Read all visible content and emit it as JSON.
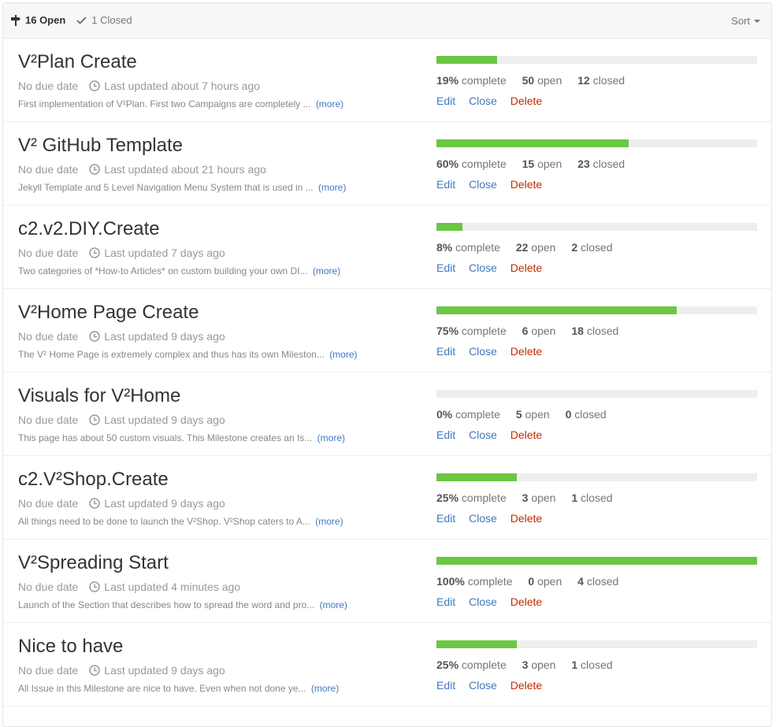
{
  "header": {
    "open_label": "16 Open",
    "closed_label": "1 Closed",
    "sort_label": "Sort",
    "open_icon": "milestone-icon",
    "closed_icon": "check-icon"
  },
  "colors": {
    "progress_fill": "#6cc644",
    "progress_track": "#eeeeee",
    "link": "#4078c0",
    "delete": "#bd2c00"
  },
  "actions": {
    "edit": "Edit",
    "close": "Close",
    "delete": "Delete",
    "more": "(more)"
  },
  "milestones": [
    {
      "title": "V²Plan Create",
      "due": "No due date",
      "updated": "Last updated about 7 hours ago",
      "description": "First implementation of V²Plan. First two Campaigns are completely ...",
      "percent": 19,
      "percent_label": "19%",
      "open_count": "50",
      "closed_count": "12"
    },
    {
      "title": "V² GitHub Template",
      "due": "No due date",
      "updated": "Last updated about 21 hours ago",
      "description": "Jekyll Template and 5 Level Navigation Menu System that is used in ...",
      "percent": 60,
      "percent_label": "60%",
      "open_count": "15",
      "closed_count": "23"
    },
    {
      "title": "c2.v2.DIY.Create",
      "due": "No due date",
      "updated": "Last updated 7 days ago",
      "description": "Two categories of *How-to Articles* on custom building your own DI...",
      "percent": 8,
      "percent_label": "8%",
      "open_count": "22",
      "closed_count": "2"
    },
    {
      "title": "V²Home Page Create",
      "due": "No due date",
      "updated": "Last updated 9 days ago",
      "description": "The V² Home Page is extremely complex and thus has its own Mileston...",
      "percent": 75,
      "percent_label": "75%",
      "open_count": "6",
      "closed_count": "18"
    },
    {
      "title": "Visuals for V²Home",
      "due": "No due date",
      "updated": "Last updated 9 days ago",
      "description": "This page has about 50 custom visuals. This Milestone creates an Is...",
      "percent": 0,
      "percent_label": "0%",
      "open_count": "5",
      "closed_count": "0"
    },
    {
      "title": "c2.V²Shop.Create",
      "due": "No due date",
      "updated": "Last updated 9 days ago",
      "description": "All things need to be done to launch the V²Shop. V²Shop caters to A...",
      "percent": 25,
      "percent_label": "25%",
      "open_count": "3",
      "closed_count": "1"
    },
    {
      "title": "V²Spreading Start",
      "due": "No due date",
      "updated": "Last updated 4 minutes ago",
      "description": "Launch of the Section that describes how to spread the word and pro...",
      "percent": 100,
      "percent_label": "100%",
      "open_count": "0",
      "closed_count": "4"
    },
    {
      "title": "Nice to have",
      "due": "No due date",
      "updated": "Last updated 9 days ago",
      "description": "All Issue in this Milestone are nice to have. Even when not done ye...",
      "percent": 25,
      "percent_label": "25%",
      "open_count": "3",
      "closed_count": "1"
    }
  ],
  "labels": {
    "complete": "complete",
    "open": "open",
    "closed": "closed"
  }
}
